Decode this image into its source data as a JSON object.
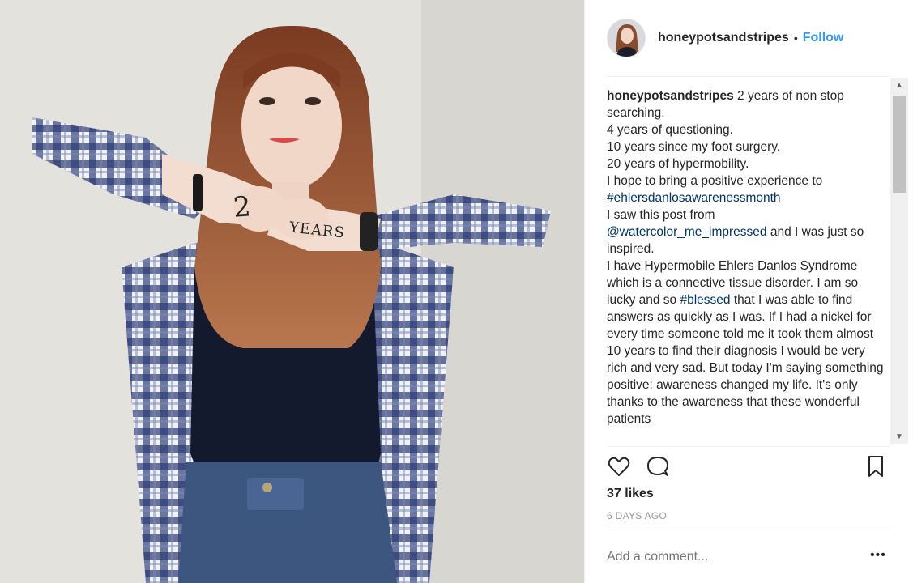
{
  "photo": {
    "hand_left_text": "2",
    "hand_right_text": "YEARS"
  },
  "header": {
    "username": "honeypotsandstripes",
    "separator": "•",
    "follow_label": "Follow"
  },
  "caption": {
    "username": "honeypotsandstripes",
    "line1": " 2 years of non stop searching.",
    "line2": "4 years of questioning.",
    "line3": "10 years since my foot surgery.",
    "line4": "20 years of hypermobility.",
    "line5": "I hope to bring a positive experience to",
    "hashtag1": "#ehlersdanlosawarenessmonth",
    "line6": "I saw this post from",
    "mention1": "@watercolor_me_impressed",
    "line7": " and I was just so inspired.",
    "line8": "I have Hypermobile Ehlers Danlos Syndrome which is a connective tissue disorder. I am so lucky and so ",
    "hashtag2": "#blessed",
    "line9": " that I was able to find answers as quickly as I was. If I had a nickel for every time someone told me it took them almost 10 years to find their diagnosis I would be very rich and very sad. But today I'm saying something positive: awareness changed my life. It's only thanks to the awareness that these wonderful patients"
  },
  "scroll": {
    "up_arrow": "▲",
    "down_arrow": "▼"
  },
  "icons": {
    "like": "heart-icon",
    "comment": "comment-icon",
    "save": "bookmark-icon"
  },
  "likes": "37 likes",
  "timestamp": "6 DAYS AGO",
  "comment_placeholder": "Add a comment...",
  "more_label": "•••",
  "colors": {
    "link": "#3897f0",
    "hashtag": "#003569",
    "text": "#262626",
    "muted": "#999999"
  }
}
